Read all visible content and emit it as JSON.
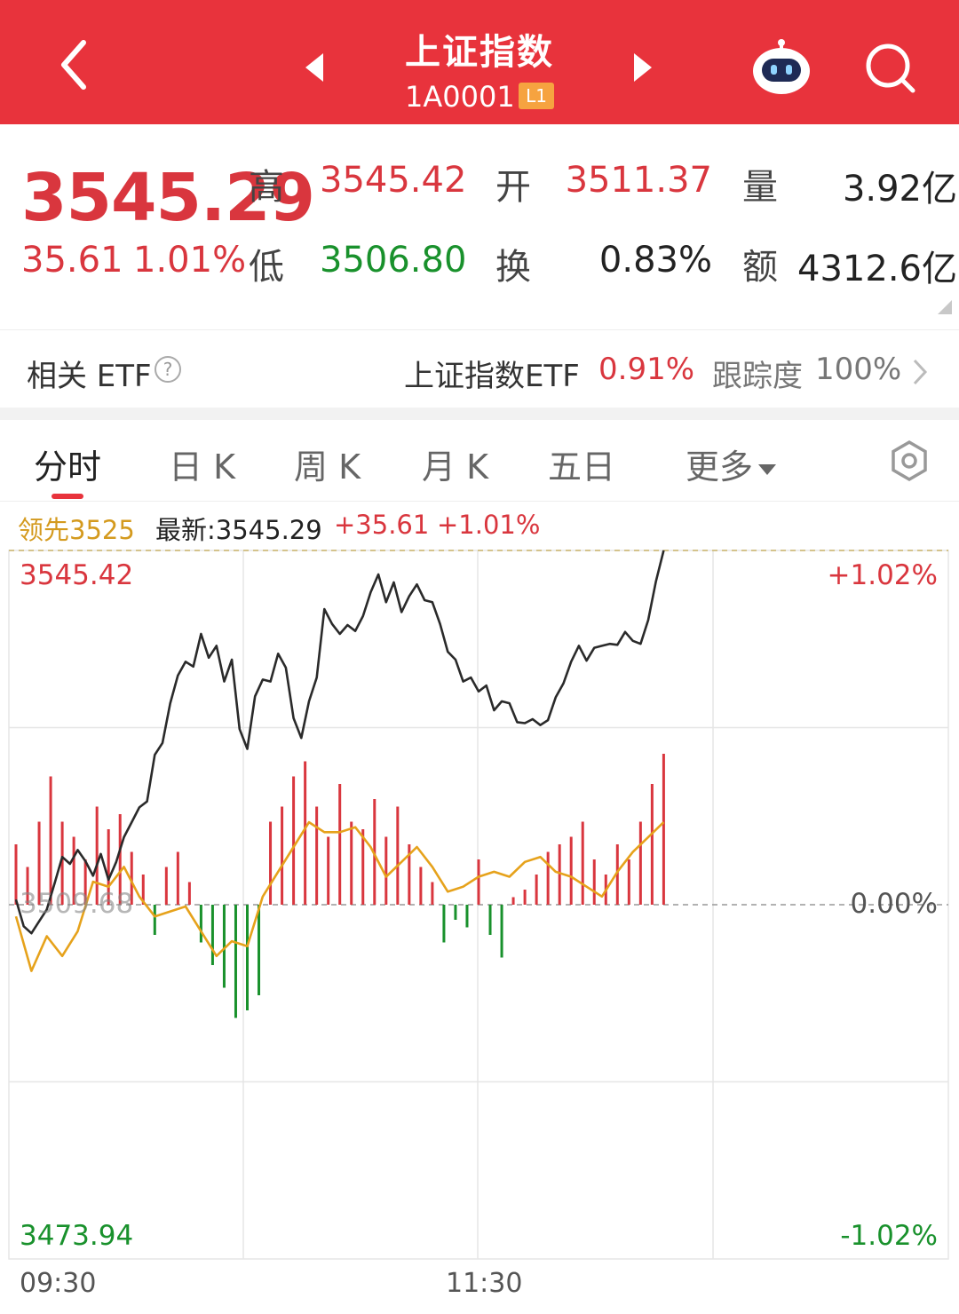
{
  "header": {
    "title": "上证指数",
    "code": "1A0001",
    "level_badge": "L1",
    "icons": [
      "back-arrow-icon",
      "prev-triangle-icon",
      "next-triangle-icon",
      "robot-assistant-icon",
      "search-icon"
    ],
    "bg_color": "#e8333c"
  },
  "quote": {
    "price": "3545.29",
    "change": "35.61",
    "change_pct": "1.01%",
    "high_label": "高",
    "high": "3545.42",
    "low_label": "低",
    "low": "3506.80",
    "open_label": "开",
    "open": "3511.37",
    "turnover_label": "换",
    "turnover": "0.83%",
    "volume_label": "量",
    "volume": "3.92亿",
    "amount_label": "额",
    "amount": "4312.6亿"
  },
  "etf": {
    "label": "相关 ETF",
    "help": "?",
    "name": "上证指数ETF",
    "pct": "0.91%",
    "track_label": "跟踪度",
    "track_value": "100%"
  },
  "tabs": [
    {
      "label": "分时",
      "active": true
    },
    {
      "label": "日 K"
    },
    {
      "label": "周 K"
    },
    {
      "label": "月 K"
    },
    {
      "label": "五日"
    },
    {
      "label": "更多"
    }
  ],
  "info": {
    "lead": "领先3525",
    "latest": "最新:3545.29",
    "change": "+35.61",
    "pct": "+1.01%"
  },
  "chart_data": {
    "type": "line",
    "y_top_label": "3545.42",
    "y_top_pct": "+1.02%",
    "y_base_label": "3509.68",
    "y_base_pct": "0.00%",
    "y_bottom_label": "3473.94",
    "y_bottom_pct": "-1.02%",
    "ylim": [
      3473.94,
      3545.42
    ],
    "base": 3509.68,
    "x_labels": [
      "09:30",
      "11:30"
    ],
    "total_minutes": 240,
    "price_points": [
      [
        0,
        3510.2
      ],
      [
        2,
        3507.5
      ],
      [
        4,
        3506.8
      ],
      [
        6,
        3508.0
      ],
      [
        8,
        3509.2
      ],
      [
        10,
        3511.8
      ],
      [
        12,
        3514.5
      ],
      [
        14,
        3513.8
      ],
      [
        16,
        3515.2
      ],
      [
        18,
        3514.1
      ],
      [
        20,
        3512.6
      ],
      [
        22,
        3514.8
      ],
      [
        24,
        3512.2
      ],
      [
        26,
        3514.0
      ],
      [
        28,
        3516.5
      ],
      [
        30,
        3518.0
      ],
      [
        32,
        3519.5
      ],
      [
        34,
        3520.1
      ],
      [
        36,
        3524.8
      ],
      [
        38,
        3526.0
      ],
      [
        40,
        3530.0
      ],
      [
        42,
        3532.8
      ],
      [
        44,
        3534.2
      ],
      [
        46,
        3533.7
      ],
      [
        48,
        3537.0
      ],
      [
        50,
        3534.6
      ],
      [
        52,
        3535.8
      ],
      [
        54,
        3532.2
      ],
      [
        56,
        3534.4
      ],
      [
        58,
        3527.4
      ],
      [
        60,
        3525.4
      ],
      [
        62,
        3530.7
      ],
      [
        64,
        3532.4
      ],
      [
        66,
        3532.2
      ],
      [
        68,
        3535.0
      ],
      [
        70,
        3533.6
      ],
      [
        72,
        3528.5
      ],
      [
        74,
        3526.5
      ],
      [
        76,
        3530.2
      ],
      [
        78,
        3532.6
      ],
      [
        80,
        3539.5
      ],
      [
        82,
        3538.0
      ],
      [
        84,
        3537.0
      ],
      [
        86,
        3537.9
      ],
      [
        88,
        3537.3
      ],
      [
        90,
        3538.8
      ],
      [
        92,
        3541.2
      ],
      [
        94,
        3543.0
      ],
      [
        96,
        3540.2
      ],
      [
        98,
        3542.2
      ],
      [
        100,
        3539.2
      ],
      [
        102,
        3540.8
      ],
      [
        104,
        3542.0
      ],
      [
        106,
        3540.4
      ],
      [
        108,
        3540.2
      ],
      [
        110,
        3538.0
      ],
      [
        112,
        3535.2
      ],
      [
        114,
        3534.4
      ],
      [
        116,
        3532.2
      ],
      [
        118,
        3532.6
      ],
      [
        120,
        3531.2
      ],
      [
        122,
        3531.8
      ],
      [
        124,
        3529.3
      ],
      [
        126,
        3530.2
      ],
      [
        128,
        3530.0
      ],
      [
        130,
        3528.1
      ],
      [
        132,
        3528.0
      ],
      [
        134,
        3528.4
      ],
      [
        136,
        3527.8
      ],
      [
        138,
        3528.3
      ],
      [
        140,
        3530.6
      ],
      [
        142,
        3532.0
      ],
      [
        144,
        3534.2
      ],
      [
        146,
        3535.8
      ],
      [
        148,
        3534.3
      ],
      [
        150,
        3535.6
      ],
      [
        152,
        3535.8
      ],
      [
        154,
        3536.0
      ],
      [
        156,
        3535.9
      ],
      [
        158,
        3537.2
      ],
      [
        160,
        3536.3
      ],
      [
        162,
        3536.0
      ],
      [
        164,
        3538.4
      ],
      [
        166,
        3542.3
      ],
      [
        168,
        3545.42
      ]
    ],
    "avg_points": [
      [
        0,
        3508.5
      ],
      [
        4,
        3503.0
      ],
      [
        8,
        3506.5
      ],
      [
        12,
        3504.5
      ],
      [
        16,
        3507.0
      ],
      [
        20,
        3512.0
      ],
      [
        24,
        3511.5
      ],
      [
        28,
        3513.5
      ],
      [
        32,
        3510.5
      ],
      [
        36,
        3508.5
      ],
      [
        40,
        3509.0
      ],
      [
        44,
        3509.5
      ],
      [
        48,
        3507.0
      ],
      [
        52,
        3504.5
      ],
      [
        56,
        3506.0
      ],
      [
        60,
        3505.5
      ],
      [
        64,
        3510.5
      ],
      [
        68,
        3513.0
      ],
      [
        72,
        3515.5
      ],
      [
        76,
        3518.0
      ],
      [
        80,
        3517.0
      ],
      [
        84,
        3517.0
      ],
      [
        88,
        3517.5
      ],
      [
        92,
        3515.5
      ],
      [
        96,
        3512.5
      ],
      [
        100,
        3514.0
      ],
      [
        104,
        3515.5
      ],
      [
        108,
        3513.5
      ],
      [
        112,
        3511.0
      ],
      [
        116,
        3511.5
      ],
      [
        120,
        3512.5
      ],
      [
        124,
        3513.0
      ],
      [
        128,
        3512.5
      ],
      [
        132,
        3514.0
      ],
      [
        136,
        3514.5
      ],
      [
        140,
        3513.0
      ],
      [
        144,
        3512.5
      ],
      [
        148,
        3511.5
      ],
      [
        152,
        3510.5
      ],
      [
        156,
        3513.0
      ],
      [
        160,
        3515.0
      ],
      [
        164,
        3516.5
      ],
      [
        168,
        3518.0
      ]
    ],
    "volume_bars": [
      [
        0,
        0.4
      ],
      [
        3,
        0.25
      ],
      [
        6,
        0.55
      ],
      [
        9,
        0.85
      ],
      [
        12,
        0.55
      ],
      [
        15,
        0.45
      ],
      [
        18,
        0.3
      ],
      [
        21,
        0.65
      ],
      [
        24,
        0.5
      ],
      [
        27,
        0.6
      ],
      [
        30,
        0.35
      ],
      [
        33,
        0.2
      ],
      [
        36,
        -0.2
      ],
      [
        39,
        0.25
      ],
      [
        42,
        0.35
      ],
      [
        45,
        0.15
      ],
      [
        48,
        -0.25
      ],
      [
        51,
        -0.4
      ],
      [
        54,
        -0.55
      ],
      [
        57,
        -0.75
      ],
      [
        60,
        -0.7
      ],
      [
        63,
        -0.6
      ],
      [
        66,
        0.55
      ],
      [
        69,
        0.65
      ],
      [
        72,
        0.85
      ],
      [
        75,
        0.95
      ],
      [
        78,
        0.65
      ],
      [
        81,
        0.45
      ],
      [
        84,
        0.8
      ],
      [
        87,
        0.55
      ],
      [
        90,
        0.5
      ],
      [
        93,
        0.7
      ],
      [
        96,
        0.45
      ],
      [
        99,
        0.65
      ],
      [
        102,
        0.4
      ],
      [
        105,
        0.25
      ],
      [
        108,
        0.15
      ],
      [
        111,
        -0.25
      ],
      [
        114,
        -0.1
      ],
      [
        117,
        -0.15
      ],
      [
        120,
        0.3
      ],
      [
        123,
        -0.2
      ],
      [
        126,
        -0.35
      ],
      [
        129,
        0.05
      ],
      [
        132,
        0.1
      ],
      [
        135,
        0.2
      ],
      [
        138,
        0.35
      ],
      [
        141,
        0.4
      ],
      [
        144,
        0.45
      ],
      [
        147,
        0.55
      ],
      [
        150,
        0.3
      ],
      [
        153,
        0.2
      ],
      [
        156,
        0.4
      ],
      [
        159,
        0.3
      ],
      [
        162,
        0.55
      ],
      [
        165,
        0.8
      ],
      [
        168,
        1.0
      ]
    ]
  }
}
